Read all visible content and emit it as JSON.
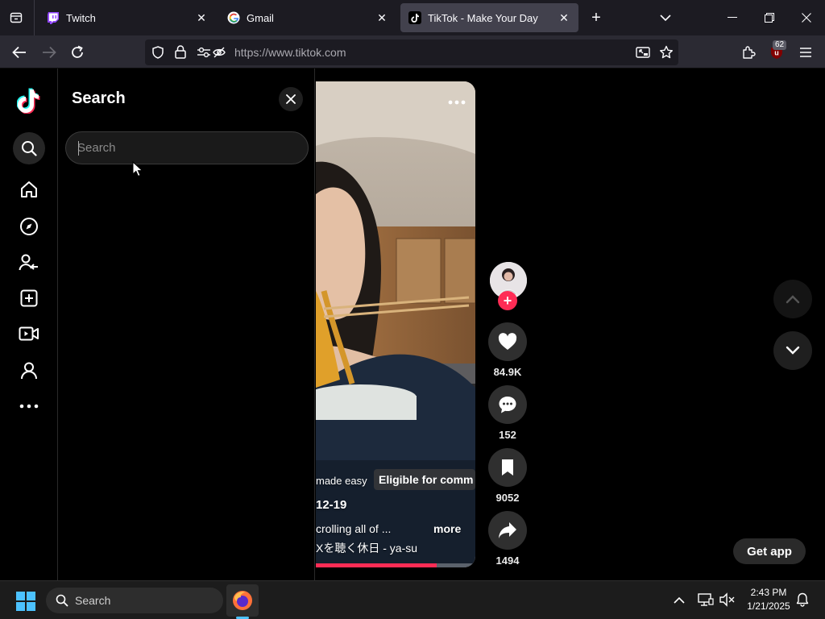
{
  "browser": {
    "tabs": [
      {
        "label": "Twitch",
        "icon": "twitch-icon",
        "active": false
      },
      {
        "label": "Gmail",
        "icon": "google-icon",
        "active": false
      },
      {
        "label": "TikTok - Make Your Day",
        "icon": "tiktok-icon",
        "active": true
      }
    ],
    "url": "https://www.tiktok.com",
    "extensions_badge": "62"
  },
  "tiktok": {
    "search_panel": {
      "title": "Search",
      "input_placeholder": "Search",
      "input_value": ""
    },
    "left_nav": [
      {
        "name": "search",
        "icon": "search-icon"
      },
      {
        "name": "home",
        "icon": "home-icon"
      },
      {
        "name": "explore",
        "icon": "compass-icon"
      },
      {
        "name": "following",
        "icon": "following-icon"
      },
      {
        "name": "upload",
        "icon": "plus-square-icon"
      },
      {
        "name": "live",
        "icon": "video-camera-icon"
      },
      {
        "name": "profile",
        "icon": "user-icon"
      },
      {
        "name": "more",
        "icon": "more-icon"
      }
    ],
    "video": {
      "tag_text": "made easy",
      "eligible_text": "Eligible for comm",
      "date": "12-19",
      "caption": "crolling all of ...",
      "more_label": "more",
      "music": "Xを聴く休日 - ya-su",
      "progress": 0.76
    },
    "actions": {
      "likes": "84.9K",
      "comments": "152",
      "saves": "9052",
      "shares": "1494"
    },
    "get_app_label": "Get app"
  },
  "taskbar": {
    "search_label": "Search",
    "time": "2:43 PM",
    "date": "1/21/2025"
  }
}
